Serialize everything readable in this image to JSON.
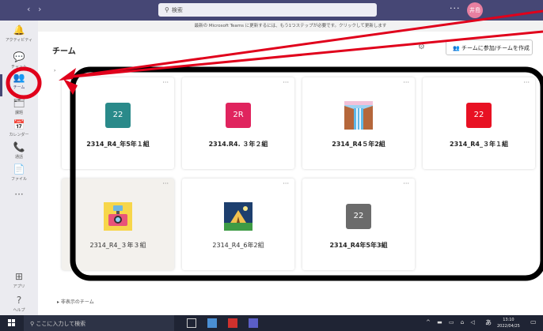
{
  "titlebar": {
    "back": "‹",
    "forward": "›",
    "search_text": "検索",
    "more": "···",
    "avatar": "井島"
  },
  "notice": "最新の Microsoft Teams に更新するには、もう1つステップが必要です。クリックして更新します",
  "rail": [
    {
      "icon": "bell-icon",
      "glyph": "🔔",
      "label": "アクティビティ"
    },
    {
      "icon": "chat-icon",
      "glyph": "💬",
      "label": "チャット"
    },
    {
      "icon": "teams-icon",
      "glyph": "👥",
      "label": "チーム"
    },
    {
      "icon": "assignments-icon",
      "glyph": "🗂",
      "label": "課題"
    },
    {
      "icon": "calendar-icon",
      "glyph": "📅",
      "label": "カレンダー"
    },
    {
      "icon": "phone-icon",
      "glyph": "📞",
      "label": "通話"
    },
    {
      "icon": "file-icon",
      "glyph": "📄",
      "label": "ファイル"
    },
    {
      "icon": "more-icon",
      "glyph": "···",
      "label": ""
    },
    {
      "icon": "apps-icon",
      "glyph": "⊞",
      "label": "アプリ"
    },
    {
      "icon": "help-icon",
      "glyph": "?",
      "label": "ヘルプ"
    }
  ],
  "header": {
    "title": "チーム",
    "join_button": "チームに参加/チームを作成",
    "section_caret": "›"
  },
  "teams": [
    {
      "name": "2314_R4_年5年１組",
      "tile_text": "22",
      "tile_color": "#2a8a8a",
      "tile_type": "text"
    },
    {
      "name": "2314.R4. ３年２組",
      "tile_text": "2R",
      "tile_color": "#e0245e",
      "tile_type": "text"
    },
    {
      "name": "2314_R4５年2組",
      "tile_text": "",
      "tile_color": "",
      "tile_type": "waterfall-image"
    },
    {
      "name": "2314_R4_３年１組",
      "tile_text": "22",
      "tile_color": "#e81123",
      "tile_type": "text"
    },
    {
      "name": "2314_R4_３年３組",
      "tile_text": "",
      "tile_color": "",
      "tile_type": "camera-image"
    },
    {
      "name": "2314_R4_6年2組",
      "tile_text": "",
      "tile_color": "",
      "tile_type": "camping-image"
    },
    {
      "name": "2314_R4年5年3組",
      "tile_text": "22",
      "tile_color": "#6b6b6b",
      "tile_type": "text"
    }
  ],
  "card_more": "···",
  "hidden_teams": "▸ 非表示のチーム",
  "taskbar": {
    "search_placeholder": "ここに入力して検索",
    "tray": "^ ▬ ▭ ⌂ ◁",
    "ime": "あ",
    "time": "13:10",
    "date": "2022/04/25"
  },
  "colors": {
    "titlebar": "#464775",
    "annotation": "#e0001b",
    "highlight_frame": "#000000"
  }
}
